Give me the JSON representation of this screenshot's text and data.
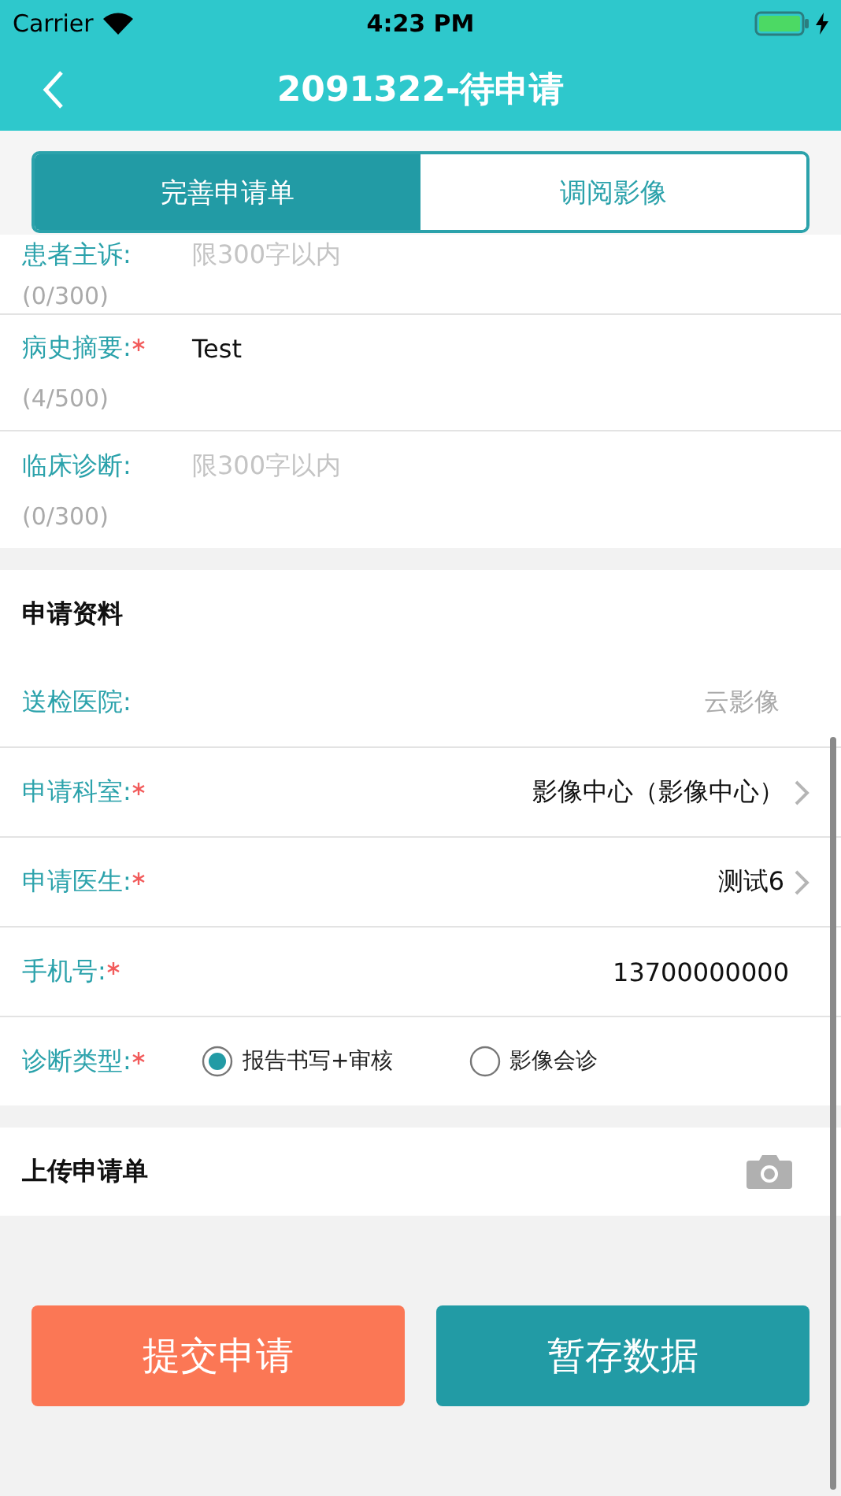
{
  "status_bar": {
    "carrier": "Carrier",
    "time": "4:23 PM"
  },
  "nav": {
    "title": "2091322-待申请"
  },
  "tabs": [
    {
      "label": "完善申请单",
      "selected": true
    },
    {
      "label": "调阅影像",
      "selected": false
    }
  ],
  "text_areas": [
    {
      "label": "患者主诉:",
      "required": false,
      "placeholder": "限300字以内",
      "counter": "(0/300)"
    },
    {
      "label": "病史摘要:",
      "required": true,
      "value": "Test",
      "counter": "(4/500)"
    },
    {
      "label": "临床诊断:",
      "required": false,
      "placeholder": "限300字以内",
      "counter": "(0/300)"
    }
  ],
  "application": {
    "title": "申请资料",
    "fields": [
      {
        "kind": "static",
        "label": "送检医院:",
        "required": false,
        "value": "云影像"
      },
      {
        "kind": "link",
        "label": "申请科室:",
        "required": true,
        "value": "影像中心（影像中心）"
      },
      {
        "kind": "link",
        "label": "申请医生:",
        "required": true,
        "value": "测试6"
      },
      {
        "kind": "input",
        "label": "手机号:",
        "required": true,
        "value": "13700000000"
      },
      {
        "kind": "radio",
        "label": "诊断类型:",
        "required": true,
        "options": [
          {
            "label": "报告书写+审核",
            "selected": true
          },
          {
            "label": "影像会诊",
            "selected": false
          }
        ]
      }
    ]
  },
  "upload": {
    "title": "上传申请单"
  },
  "buttons": [
    {
      "label": "提交申请",
      "kind": "submit"
    },
    {
      "label": "暂存数据",
      "kind": "save"
    }
  ]
}
